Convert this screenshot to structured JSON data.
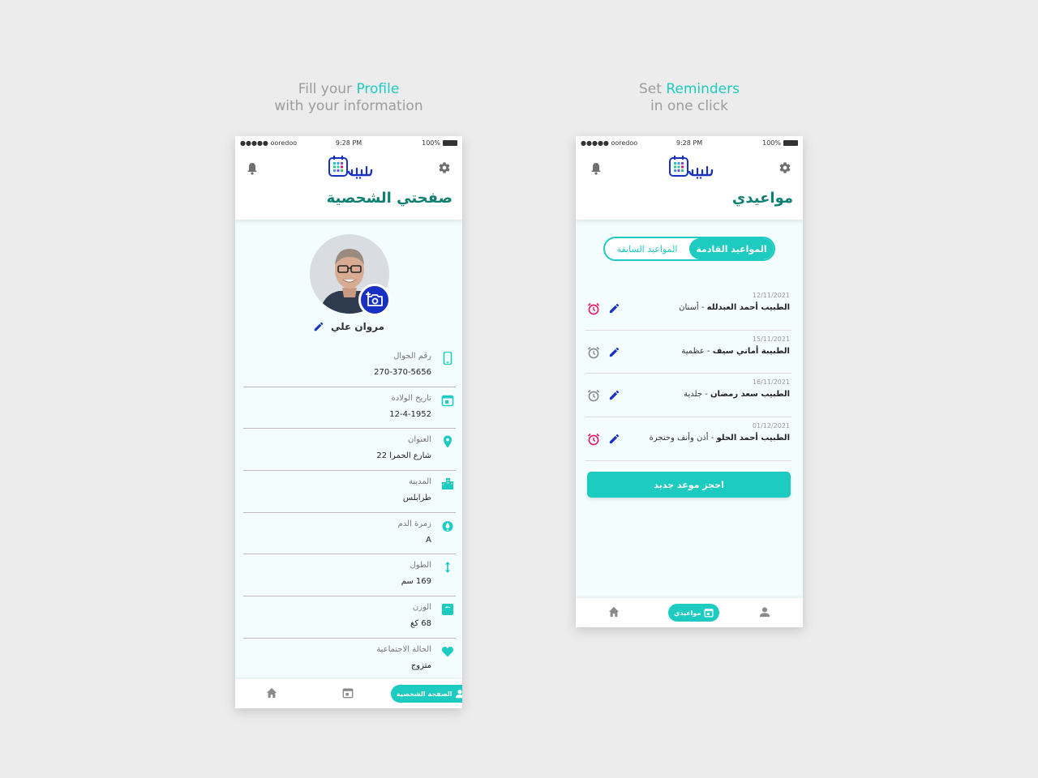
{
  "colors": {
    "accent": "#1ecbc0",
    "title_green": "#0f7f72",
    "brand_blue": "#1831c4",
    "alarm_red": "#e0166c",
    "gray": "#8a8a8a"
  },
  "left_caption": {
    "line1_prefix": "Fill your ",
    "line1_accent": "Profile",
    "line2": "with your information"
  },
  "right_caption": {
    "line1_prefix": "Set ",
    "line1_accent": "Reminders",
    "line2": "in one click"
  },
  "status_bar": {
    "carrier": "●●●●● ooredoo",
    "time": "9:28 PM",
    "battery": "100%"
  },
  "profile_screen": {
    "title": "صفحتي الشحصية",
    "user_name": "مروان علي",
    "fields": [
      {
        "label": "رقم الجوال",
        "value": "270-370-5656",
        "icon": "phone-icon"
      },
      {
        "label": "تاريخ الولادة",
        "value": "12-4-1952",
        "icon": "calendar-icon"
      },
      {
        "label": "العنوان",
        "value": "شارع الحمرا 22",
        "icon": "location-pin-icon"
      },
      {
        "label": "المدينة",
        "value": "طرابلس",
        "icon": "city-icon"
      },
      {
        "label": "زمرة الدم",
        "value": "A",
        "icon": "blood-drop-icon"
      },
      {
        "label": "الطول",
        "value": "169 سم",
        "icon": "height-arrows-icon"
      },
      {
        "label": "الوزن",
        "value": "68 كغ",
        "icon": "scale-icon"
      },
      {
        "label": "الحالة الاجتماعية",
        "value": "متزوج",
        "icon": "heart-icon"
      }
    ],
    "tabbar": {
      "active_label": "الصفحة الشخصية"
    }
  },
  "appointments_screen": {
    "title": "مواعيدي",
    "segment": {
      "upcoming": "المواعيد القادمة",
      "past": "المواعيد السابقة"
    },
    "appointments": [
      {
        "date": "12/11/2021",
        "doctor": "الطبيب أحمد العبدلله",
        "specialty": " - أسنان",
        "reminder_on": true
      },
      {
        "date": "15/11/2021",
        "doctor": "الطبيبة أماني سيف",
        "specialty": " - عظمية",
        "reminder_on": false
      },
      {
        "date": "16/11/2021",
        "doctor": "الطبيب سعد رمضان",
        "specialty": " - جلدية",
        "reminder_on": false
      },
      {
        "date": "01/12/2021",
        "doctor": "الطبيب أحمد الحلو",
        "specialty": " - أذن وأنف وحنجرة",
        "reminder_on": true
      }
    ],
    "book_button": "احجز موعد جديد",
    "tabbar": {
      "active_label": "مواعيدي"
    }
  }
}
